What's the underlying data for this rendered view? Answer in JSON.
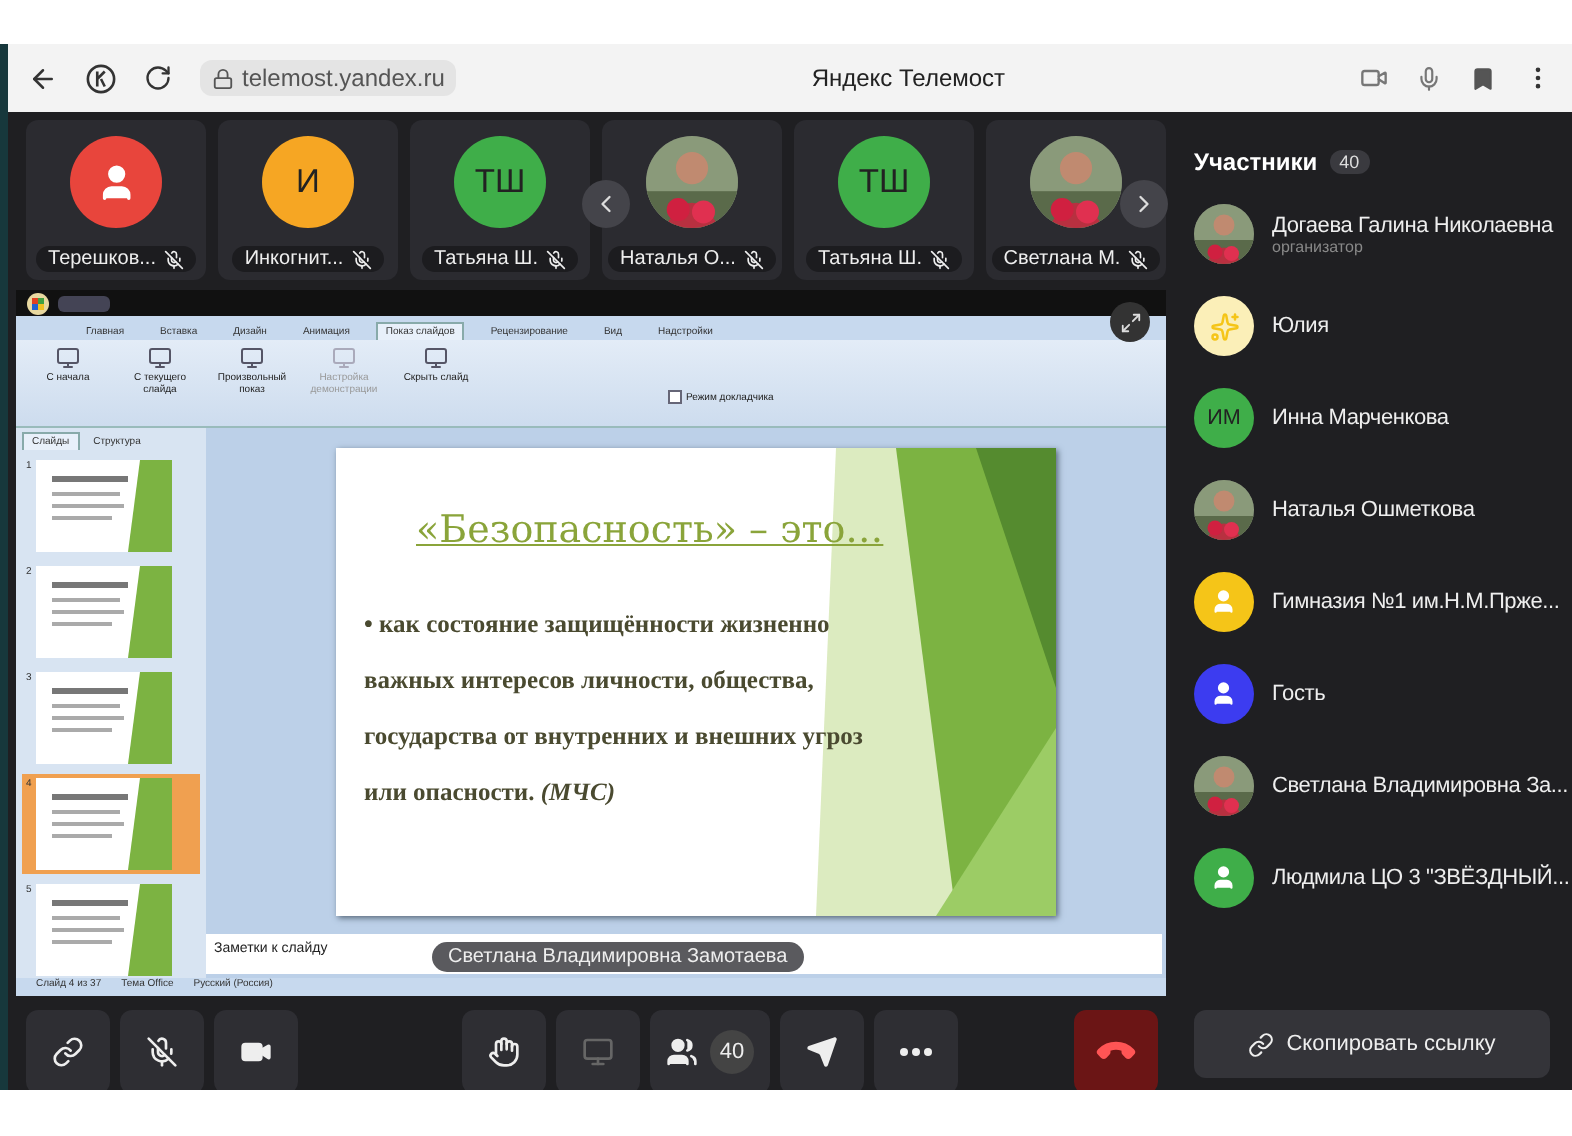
{
  "browser": {
    "url": "telemost.yandex.ru",
    "title": "Яндекс Телемост"
  },
  "tiles": [
    {
      "name": "Терешков...",
      "muted": true,
      "avatar": {
        "kind": "person",
        "color": "#e8453c"
      }
    },
    {
      "name": "Инкогнит...",
      "muted": true,
      "avatar": {
        "kind": "initials",
        "text": "И",
        "color": "#f6a623"
      }
    },
    {
      "name": "Татьяна Ш.",
      "muted": true,
      "avatar": {
        "kind": "initials",
        "text": "ТШ",
        "color": "#3fae49"
      }
    },
    {
      "name": "Наталья О...",
      "muted": true
    },
    {
      "name": "Татьяна Ш.",
      "muted": true,
      "avatar": {
        "kind": "initials",
        "text": "ТШ",
        "color": "#3fae49"
      }
    },
    {
      "name": "Светлана М.",
      "muted": true
    }
  ],
  "screen_share": {
    "speaker": "Светлана Владимировна Замотаева",
    "ribbon_tabs": [
      {
        "label": "Главная",
        "selected": false
      },
      {
        "label": "Вставка",
        "selected": false
      },
      {
        "label": "Дизайн",
        "selected": false
      },
      {
        "label": "Анимация",
        "selected": false
      },
      {
        "label": "Показ слайдов",
        "selected": true
      },
      {
        "label": "Рецензирование",
        "selected": false
      },
      {
        "label": "Вид",
        "selected": false
      },
      {
        "label": "Надстройки",
        "selected": false
      }
    ],
    "ribbon_buttons": [
      {
        "label": "С начала",
        "disabled": false
      },
      {
        "label": "С текущего слайда",
        "disabled": false
      },
      {
        "label": "Произвольный показ",
        "disabled": false
      },
      {
        "label": "Настройка демонстрации",
        "disabled": true
      },
      {
        "label": "Скрыть слайд",
        "disabled": false
      }
    ],
    "presenter_mode": {
      "label": "Режим докладчика",
      "checked": false
    },
    "pane_tabs": [
      {
        "label": "Слайды",
        "selected": true
      },
      {
        "label": "Структура",
        "selected": false
      }
    ],
    "thumbnails": [
      {
        "number": "1",
        "selected": false
      },
      {
        "number": "2",
        "selected": false
      },
      {
        "number": "3",
        "selected": false
      },
      {
        "number": "4",
        "selected": true
      },
      {
        "number": "5",
        "selected": false
      }
    ],
    "slide": {
      "title": "«Безопасность» – это…",
      "bullet_mark": "•",
      "bullet": "как состояние защищённости жизненно важных интересов личности, общества, государства от внутренних и внешних угроз или опасности. *(МЧС)*"
    },
    "notes_placeholder": "Заметки к слайду",
    "status": [
      "Слайд 4 из 37",
      "Тема Office",
      "Русский (Россия)"
    ]
  },
  "toolbar": [
    {
      "kind": "link"
    },
    {
      "kind": "mic",
      "muted": true
    },
    {
      "kind": "camera"
    },
    {
      "kind": "gap"
    },
    {
      "kind": "hand"
    },
    {
      "kind": "screen",
      "disabled": true
    },
    {
      "kind": "participants",
      "count": "40"
    },
    {
      "kind": "share"
    },
    {
      "kind": "more"
    },
    {
      "kind": "spacer"
    },
    {
      "kind": "end_call"
    }
  ],
  "participants": {
    "title": "Участники",
    "count": "40",
    "items": [
      {
        "name": "Догаева Галина Николаевна",
        "role": "организатор"
      },
      {
        "name": "Юлия",
        "avatar": {
          "kind": "sparkle",
          "color": "#fbefb8"
        }
      },
      {
        "name": "Инна Марченкова",
        "avatar": {
          "kind": "initials",
          "text": "ИМ",
          "color": "#3fae49"
        }
      },
      {
        "name": "Наталья Ошметкова"
      },
      {
        "name": "Гимназия №1 им.Н.М.Прже...",
        "avatar": {
          "kind": "person",
          "color": "#f5c518"
        }
      },
      {
        "name": "Гость",
        "avatar": {
          "kind": "person",
          "color": "#3c3cf0"
        }
      },
      {
        "name": "Светлана Владимировна За..."
      },
      {
        "name": "Людмила ЦО 3 \"ЗВЁЗДНЫЙ...",
        "avatar": {
          "kind": "person",
          "color": "#3fae49"
        }
      }
    ]
  },
  "copy_link": "Скопировать ссылку"
}
